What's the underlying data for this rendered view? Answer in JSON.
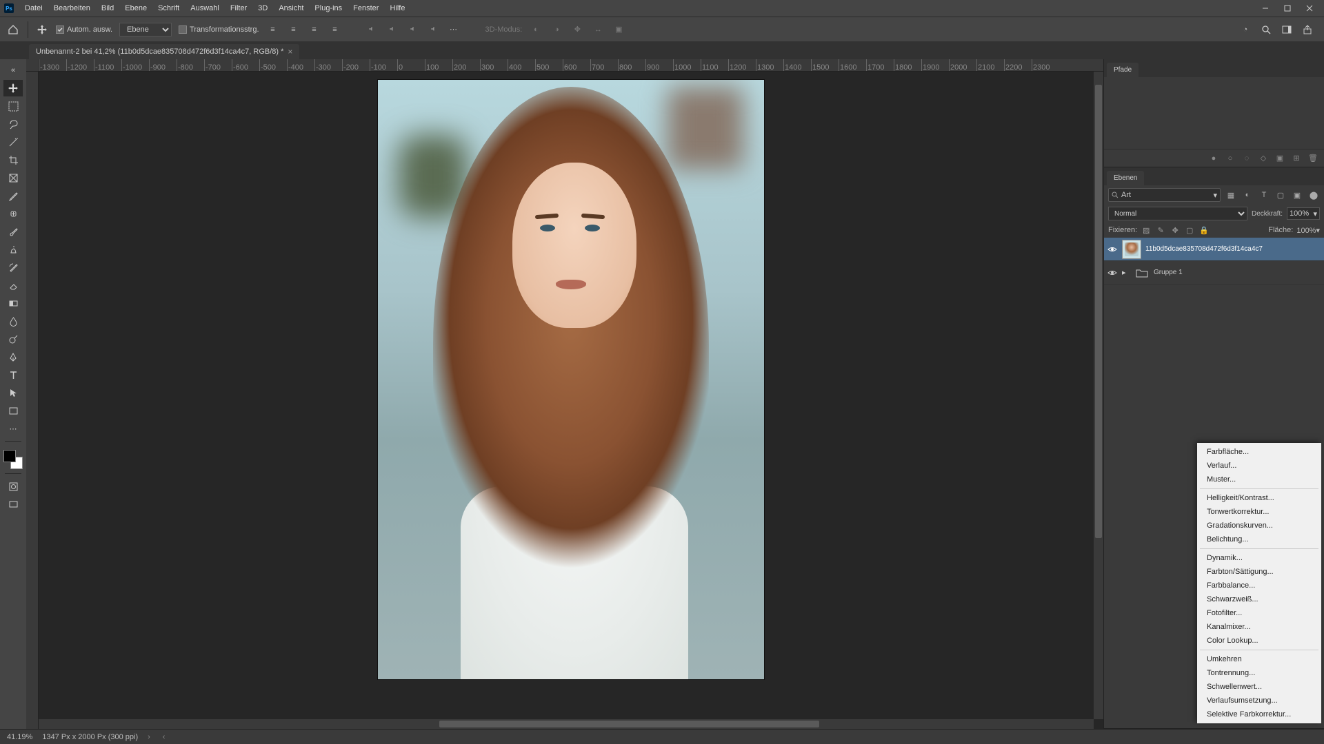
{
  "menubar": {
    "items": [
      "Datei",
      "Bearbeiten",
      "Bild",
      "Ebene",
      "Schrift",
      "Auswahl",
      "Filter",
      "3D",
      "Ansicht",
      "Plug-ins",
      "Fenster",
      "Hilfe"
    ]
  },
  "optionsbar": {
    "auto_select_label": "Autom. ausw.",
    "layer_dropdown": "Ebene",
    "transform_label": "Transformationsstrg.",
    "mode3d_label": "3D-Modus:"
  },
  "doctab": {
    "title": "Unbenannt-2 bei 41,2% (11b0d5dcae835708d472f6d3f14ca4c7, RGB/8) *"
  },
  "ruler_values": [
    "-1300",
    "-1200",
    "-1100",
    "-1000",
    "-900",
    "-800",
    "-700",
    "-600",
    "-500",
    "-400",
    "-300",
    "-200",
    "-100",
    "0",
    "100",
    "200",
    "300",
    "400",
    "500",
    "600",
    "700",
    "800",
    "900",
    "1000",
    "1100",
    "1200",
    "1300",
    "1400",
    "1500",
    "1600",
    "1700",
    "1800",
    "1900",
    "2000",
    "2100",
    "2200",
    "2300"
  ],
  "panels": {
    "pfade_tab": "Pfade",
    "ebenen_tab": "Ebenen",
    "search_kind": "Art",
    "blend_mode": "Normal",
    "opacity_label": "Deckkraft:",
    "opacity_value": "100%",
    "lock_label": "Fixieren:",
    "fill_label": "Fläche:",
    "fill_value": "100%",
    "layers": [
      {
        "name": "11b0d5dcae835708d472f6d3f14ca4c7"
      },
      {
        "name": "Gruppe 1"
      }
    ]
  },
  "adj_menu": {
    "g1": [
      "Farbfläche...",
      "Verlauf...",
      "Muster..."
    ],
    "g2": [
      "Helligkeit/Kontrast...",
      "Tonwertkorrektur...",
      "Gradationskurven...",
      "Belichtung..."
    ],
    "g3": [
      "Dynamik...",
      "Farbton/Sättigung...",
      "Farbbalance...",
      "Schwarzweiß...",
      "Fotofilter...",
      "Kanalmixer...",
      "Color Lookup..."
    ],
    "g4": [
      "Umkehren",
      "Tontrennung...",
      "Schwellenwert...",
      "Verlaufsumsetzung...",
      "Selektive Farbkorrektur..."
    ]
  },
  "statusbar": {
    "zoom": "41.19%",
    "docinfo": "1347 Px x 2000 Px (300 ppi)"
  }
}
